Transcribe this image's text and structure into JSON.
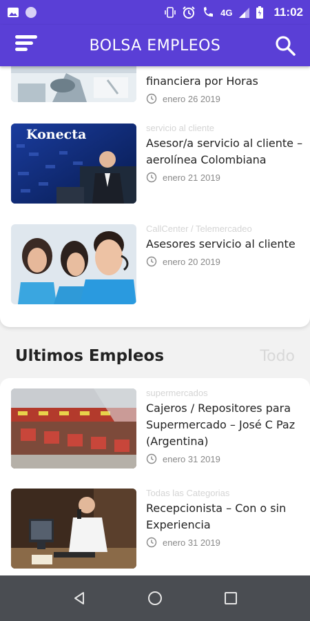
{
  "status_bar": {
    "network": "4G",
    "time": "11:02"
  },
  "app_bar": {
    "title": "BOLSA EMPLEOS"
  },
  "featured_jobs": [
    {
      "category": "",
      "title": "financiera por Horas",
      "date": "enero 26 2019"
    },
    {
      "category": "servicio al cliente",
      "title": "Asesor/a servicio al cliente – aerolínea Colombiana",
      "date": "enero 21 2019",
      "image_text": "Konecta"
    },
    {
      "category": "CallCenter / Telemercadeo",
      "title": "Asesores servicio al cliente",
      "date": "enero 20 2019"
    }
  ],
  "latest_section": {
    "title": "Ultimos Empleos",
    "link": "Todo"
  },
  "latest_jobs": [
    {
      "category": "supermercados",
      "title": "Cajeros / Repositores para Supermercado – José C Paz (Argentina)",
      "date": "enero 31 2019"
    },
    {
      "category": "Todas las Categorias",
      "title": "Recepcionista – Con o sin Experiencia",
      "date": "enero 31 2019"
    }
  ],
  "colors": {
    "primary": "#5a3fd6",
    "nav": "#4a4d52",
    "category": "#d4d4d4",
    "date": "#888888"
  },
  "icons": [
    "image-icon",
    "circle-icon",
    "vibrate-icon",
    "alarm-icon",
    "wifi-call-icon",
    "signal-icon",
    "battery-icon",
    "menu-icon",
    "search-icon",
    "clock-icon",
    "back-icon",
    "home-icon",
    "recents-icon"
  ]
}
